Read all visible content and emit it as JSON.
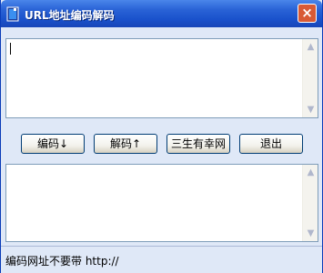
{
  "window": {
    "title": "URL地址编码解码",
    "close_glyph": "×",
    "accent_color": "#2a63d6"
  },
  "input_box": {
    "value": "",
    "scroll_up_icon": "scroll-up-arrow",
    "scroll_down_icon": "scroll-down-arrow"
  },
  "buttons": {
    "encode": "编码↓",
    "decode": "解码↑",
    "sansheng": "三生有幸网",
    "exit": "退出"
  },
  "output_box": {
    "value": ""
  },
  "status": {
    "text": "编码网址不要带 http://"
  }
}
